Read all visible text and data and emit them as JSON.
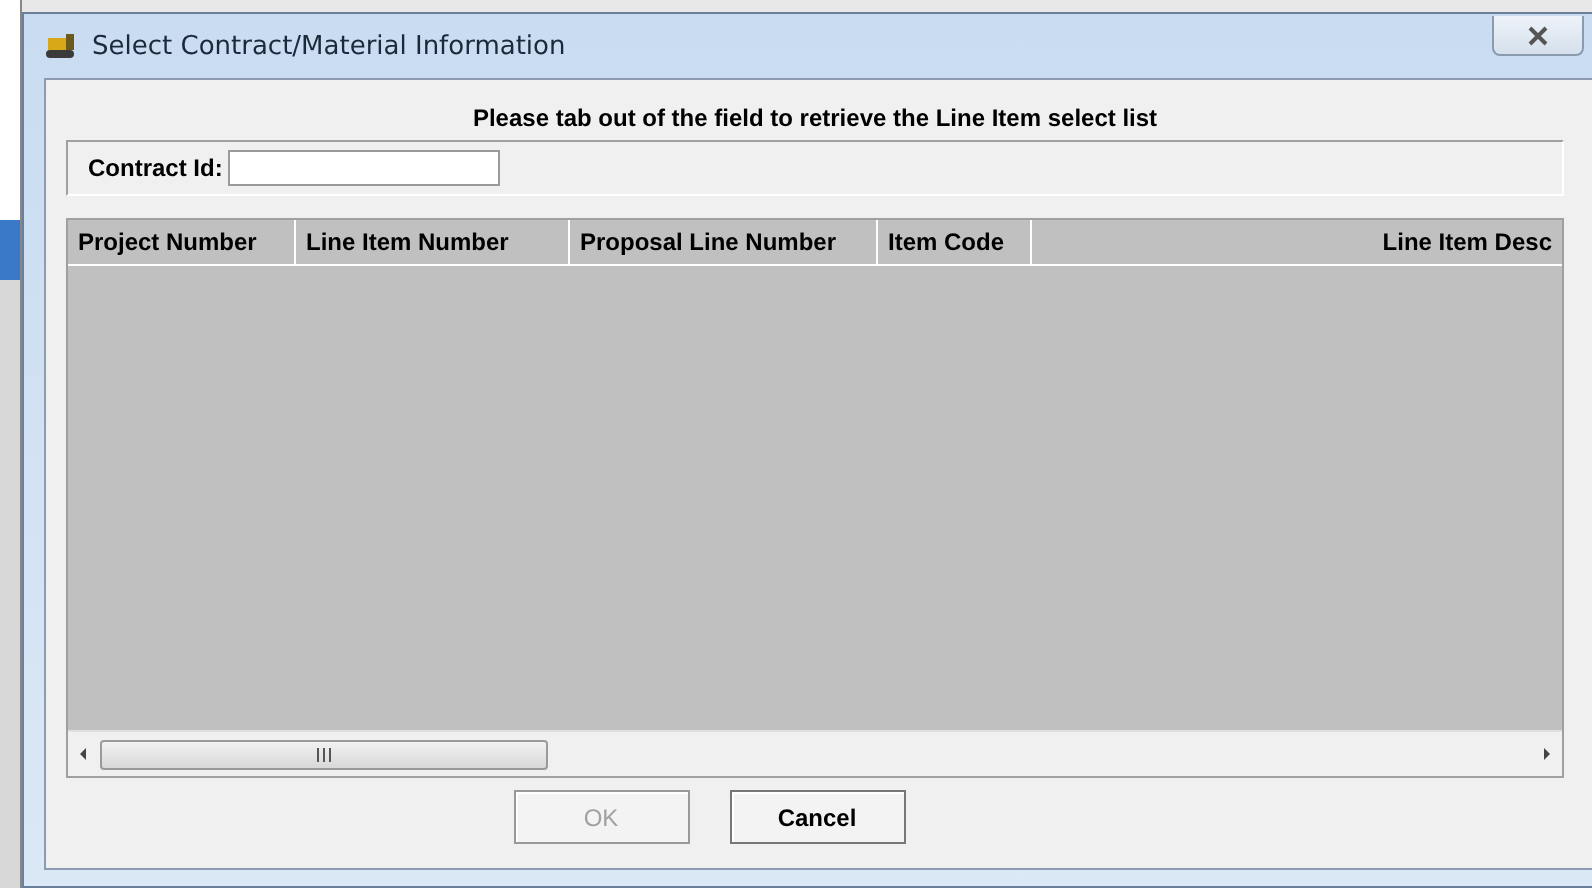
{
  "window": {
    "title": "Select Contract/Material Information"
  },
  "instruction": "Please tab out of the field to retrieve the Line Item select list",
  "contract_field": {
    "label": "Contract Id:"
  },
  "table": {
    "columns": [
      "Project Number",
      "Line Item Number",
      "Proposal Line Number",
      "Item Code",
      "Line Item Desc"
    ]
  },
  "buttons": [
    {
      "label": "OK",
      "disabled": true
    },
    {
      "label": "Cancel",
      "disabled": false
    }
  ]
}
